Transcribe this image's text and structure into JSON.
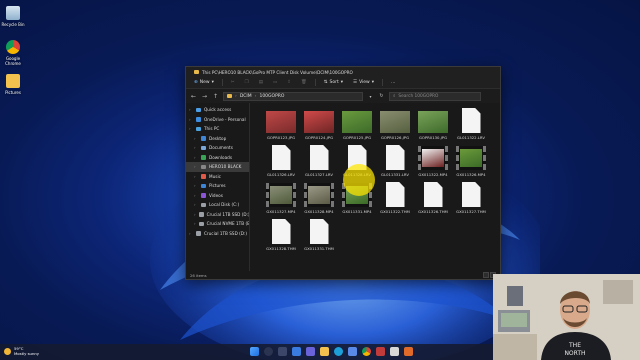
{
  "desktop": {
    "icons": [
      {
        "name": "recycle-bin",
        "label": "Recycle Bin"
      },
      {
        "name": "google-chrome",
        "label": "Google Chrome"
      },
      {
        "name": "pictures",
        "label": "Pictures"
      }
    ]
  },
  "window": {
    "title": "This PC\\HERO10 BLACK\\GoPro MTP Client Disk Volume\\DCIM\\100GOPRO",
    "toolbar": {
      "new_label": "New",
      "sort_label": "Sort",
      "view_label": "View",
      "more_label": "..."
    },
    "breadcrumb": [
      "DCIM",
      "100GOPRO"
    ],
    "search_placeholder": "Search 100GOPRO",
    "status_text": "26 items"
  },
  "sidebar": {
    "items": [
      {
        "label": "Quick access",
        "icon": "star-icon",
        "color": "#4a9fe8",
        "indent": 0
      },
      {
        "label": "OneDrive - Personal",
        "icon": "cloud-icon",
        "color": "#3b8ee0",
        "indent": 0
      },
      {
        "label": "This PC",
        "icon": "computer-icon",
        "color": "#4aa3df",
        "indent": 0
      },
      {
        "label": "Desktop",
        "icon": "desktop-icon",
        "color": "#3d86d6",
        "indent": 1
      },
      {
        "label": "Documents",
        "icon": "documents-icon",
        "color": "#7aa7d8",
        "indent": 1
      },
      {
        "label": "Downloads",
        "icon": "download-icon",
        "color": "#39a356",
        "indent": 1
      },
      {
        "label": "HERO10 BLACK",
        "icon": "camera-icon",
        "color": "#888888",
        "indent": 1,
        "selected": true
      },
      {
        "label": "Music",
        "icon": "music-icon",
        "color": "#e05a4a",
        "indent": 1
      },
      {
        "label": "Pictures",
        "icon": "pictures-icon",
        "color": "#3d86d6",
        "indent": 1
      },
      {
        "label": "Videos",
        "icon": "videos-icon",
        "color": "#8b55d6",
        "indent": 1
      },
      {
        "label": "Local Disk (C:)",
        "icon": "drive-icon",
        "color": "#9aa0a6",
        "indent": 1
      },
      {
        "label": "Crucial 1TB SSD (D:)",
        "icon": "drive-icon",
        "color": "#9aa0a6",
        "indent": 1
      },
      {
        "label": "Crucial NVME 1TB (E:)",
        "icon": "drive-icon",
        "color": "#9aa0a6",
        "indent": 1
      },
      {
        "label": "Crucial 1TB SSD (D:)",
        "icon": "drive-icon",
        "color": "#9aa0a6",
        "indent": 0
      }
    ]
  },
  "files": [
    {
      "name": "GOPR0123.JPG",
      "kind": "photo",
      "colors": [
        "#7a2b2b",
        "#c04848"
      ]
    },
    {
      "name": "GOPR0124.JPG",
      "kind": "photo",
      "colors": [
        "#6e2525",
        "#d24a4a"
      ]
    },
    {
      "name": "GOPR0125.JPG",
      "kind": "photo",
      "colors": [
        "#3d6b2a",
        "#6a9a3e"
      ]
    },
    {
      "name": "GOPR0126.JPG",
      "kind": "photo",
      "colors": [
        "#55603f",
        "#8a8d70"
      ]
    },
    {
      "name": "GOPR0130.JPG",
      "kind": "photo",
      "colors": [
        "#3e6a2b",
        "#79a35a"
      ]
    },
    {
      "name": "GL011322.LRV",
      "kind": "doc"
    },
    {
      "name": "GL011326.LRV",
      "kind": "doc"
    },
    {
      "name": "GL011327.LRV",
      "kind": "doc"
    },
    {
      "name": "GL011328.LRV",
      "kind": "doc"
    },
    {
      "name": "GL011331.LRV",
      "kind": "doc"
    },
    {
      "name": "GX011322.MP4",
      "kind": "video",
      "colors": [
        "#6b1f1f",
        "#f0f0f0"
      ]
    },
    {
      "name": "GX011326.MP4",
      "kind": "video",
      "colors": [
        "#3b6a27",
        "#6b9a3b"
      ]
    },
    {
      "name": "GX011327.MP4",
      "kind": "video",
      "colors": [
        "#4f5a3a",
        "#8a8f78"
      ]
    },
    {
      "name": "GX011328.MP4",
      "kind": "video",
      "colors": [
        "#5a5a46",
        "#9b9a88"
      ]
    },
    {
      "name": "GX011331.MP4",
      "kind": "video",
      "colors": [
        "#3a6a26",
        "#78a35a"
      ]
    },
    {
      "name": "GX011322.THM",
      "kind": "doc"
    },
    {
      "name": "GX011326.THM",
      "kind": "doc"
    },
    {
      "name": "GX011327.THM",
      "kind": "doc"
    },
    {
      "name": "GX011328.THM",
      "kind": "doc"
    },
    {
      "name": "GX011331.THM",
      "kind": "doc"
    }
  ],
  "taskbar": {
    "weather_temp": "59°C",
    "weather_desc": "Mostly sunny"
  },
  "webcam": {
    "shirt_text_1": "THE",
    "shirt_text_2": "NORTH"
  }
}
